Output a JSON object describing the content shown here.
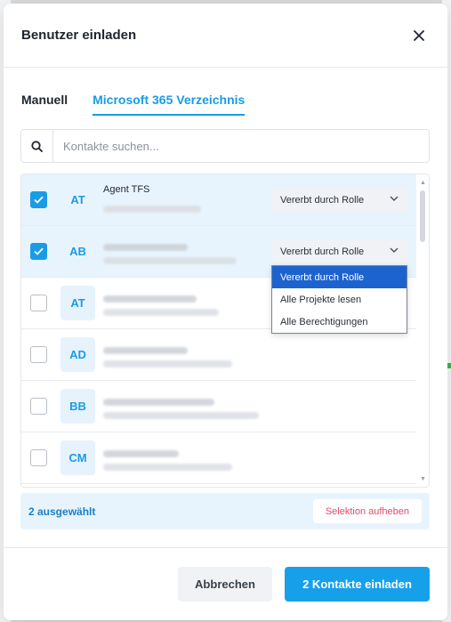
{
  "dialog": {
    "title": "Benutzer einladen",
    "close_icon": "close-icon"
  },
  "tabs": [
    {
      "label": "Manuell",
      "active": false
    },
    {
      "label": "Microsoft 365 Verzeichnis",
      "active": true
    }
  ],
  "search": {
    "placeholder": "Kontakte suchen...",
    "value": ""
  },
  "contacts": [
    {
      "initials": "AT",
      "name": "Agent TFS",
      "checked": true,
      "role": "Vererbt durch Rolle"
    },
    {
      "initials": "AB",
      "name": "",
      "checked": true,
      "role": "Vererbt durch Rolle"
    },
    {
      "initials": "AT",
      "name": "",
      "checked": false
    },
    {
      "initials": "AD",
      "name": "",
      "checked": false
    },
    {
      "initials": "BB",
      "name": "",
      "checked": false
    },
    {
      "initials": "CM",
      "name": "",
      "checked": false
    }
  ],
  "role_dropdown": {
    "options": [
      "Vererbt durch Rolle",
      "Alle Projekte lesen",
      "Alle Berechtigungen"
    ],
    "highlighted": "Vererbt durch Rolle"
  },
  "selection": {
    "count_label": "2 ausgewählt",
    "clear_label": "Selektion aufheben"
  },
  "footer": {
    "cancel_label": "Abbrechen",
    "submit_label": "2 Kontakte einladen"
  },
  "colors": {
    "accent": "#1a9be6",
    "selected_row": "#e8f4fd",
    "danger": "#e24b6b",
    "dropdown_active": "#1d63cf"
  }
}
